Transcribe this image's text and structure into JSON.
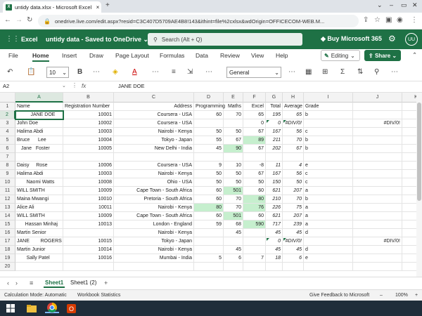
{
  "browser": {
    "tab_title": "untidy data.xlsx - Microsoft Excel",
    "tab_close": "×",
    "new_tab": "+",
    "url": "onedrive.live.com/edit.aspx?resid=C3C407D5709AE4B8!143&ithint=file%2cxlsx&wdOrigin=OFFICECOM-WEB.M..."
  },
  "excel_header": {
    "app_name": "Excel",
    "doc_status": "untidy data  -  Saved to OneDrive ⌄",
    "search_placeholder": "Search (Alt + Q)",
    "buy": "Buy Microsoft 365",
    "avatar": "UU"
  },
  "menu": [
    "File",
    "Home",
    "Insert",
    "Draw",
    "Page Layout",
    "Formulas",
    "Data",
    "Review",
    "View",
    "Help"
  ],
  "active_menu": "Home",
  "editing_label": "Editing",
  "share_label": "Share",
  "ribbon": {
    "font_size": "10",
    "number_format": "General"
  },
  "formula_bar": {
    "name_box": "A2",
    "fx": "fx",
    "value": "JANE DOE"
  },
  "columns": [
    "A",
    "B",
    "C",
    "D",
    "E",
    "F",
    "G",
    "H",
    "I",
    "J",
    "K"
  ],
  "rows": [
    {
      "n": "1",
      "c": [
        "Name",
        "Registration Number",
        "Address",
        "Programming",
        "Maths",
        "Excel",
        "Total",
        "Average",
        "Grade",
        "",
        ""
      ]
    },
    {
      "n": "2",
      "c": [
        "          JANE DOE",
        "10001",
        "Coursera - USA",
        "60",
        "70",
        "65",
        "195",
        "65",
        "b",
        "",
        ""
      ]
    },
    {
      "n": "3",
      "c": [
        "John Doe",
        "10002",
        "Coursera - USA",
        "",
        "",
        "0",
        "0",
        "#DIV/0!",
        "",
        "#DIV/0!",
        ""
      ]
    },
    {
      "n": "4",
      "c": [
        "Halima Abdi",
        "10003",
        "Nairobi - Kenya",
        "50",
        "50",
        "67",
        "167",
        "56",
        "c",
        "",
        ""
      ]
    },
    {
      "n": "5",
      "c": [
        "Bruce      Lee",
        "10004",
        "Tokyo - Japan",
        "55",
        "67",
        "89",
        "211",
        "70",
        "b",
        "",
        ""
      ]
    },
    {
      "n": "6",
      "c": [
        "   Jane   Foster",
        "10005",
        "New Delhi - India",
        "45",
        "90",
        "67",
        "202",
        "67",
        "b",
        "",
        ""
      ]
    },
    {
      "n": "7",
      "c": [
        "",
        "",
        "",
        "",
        "",
        "",
        "",
        "",
        "",
        "",
        ""
      ]
    },
    {
      "n": "8",
      "c": [
        "Daisy     Rose",
        "10006",
        "Coursera - USA",
        "9",
        "10",
        "-8",
        "11",
        "4",
        "e",
        "",
        ""
      ]
    },
    {
      "n": "9",
      "c": [
        "Halima Abdi",
        "10003",
        "Nairobi - Kenya",
        "50",
        "50",
        "67",
        "167",
        "56",
        "c",
        "",
        ""
      ]
    },
    {
      "n": "10",
      "c": [
        "       Naomi Watts",
        "10008",
        "Ohio - USA",
        "50",
        "50",
        "50",
        "150",
        "50",
        "c",
        "",
        ""
      ]
    },
    {
      "n": "11",
      "c": [
        "WILL SMITH",
        "10009",
        "Cape Town - South Africa",
        "60",
        "501",
        "60",
        "621",
        "207",
        "a",
        "",
        ""
      ]
    },
    {
      "n": "12",
      "c": [
        "Maina Mwangi",
        "10010",
        "Pretoria - South Africa",
        "60",
        "70",
        "80",
        "210",
        "70",
        "b",
        "",
        ""
      ]
    },
    {
      "n": "13",
      "c": [
        "Alice Ali",
        "10011",
        "Nairobi - Kenya",
        "80",
        "70",
        "76",
        "226",
        "75",
        "a",
        "",
        ""
      ]
    },
    {
      "n": "14",
      "c": [
        "WILL SMITH",
        "10009",
        "Cape Town - South Africa",
        "60",
        "501",
        "60",
        "621",
        "207",
        "a",
        "",
        ""
      ]
    },
    {
      "n": "15",
      "c": [
        "      Hassan Minhaj",
        "10013",
        "London - England",
        "59",
        "68",
        "590",
        "717",
        "239",
        "a",
        "",
        ""
      ]
    },
    {
      "n": "16",
      "c": [
        "Martin Senior",
        "",
        "Nairobi - Kenya",
        "",
        "45",
        "",
        "45",
        "45",
        "d",
        "",
        ""
      ]
    },
    {
      "n": "17",
      "c": [
        "JANE        ROGERS",
        "10015",
        "Tokyo - Japan",
        "",
        "",
        "",
        "0",
        "#DIV/0!",
        "",
        "#DIV/0!",
        ""
      ]
    },
    {
      "n": "18",
      "c": [
        "Martin Junior",
        "10014",
        "Nairobi - Kenya",
        "",
        "45",
        "",
        "45",
        "45",
        "d",
        "",
        ""
      ]
    },
    {
      "n": "19",
      "c": [
        "       Sally Patel",
        "10016",
        "Mumbai - India",
        "5",
        "6",
        "7",
        "18",
        "6",
        "e",
        "",
        ""
      ]
    },
    {
      "n": "20",
      "c": [
        "",
        "",
        "",
        "",
        "",
        "",
        "",
        "",
        "",
        "",
        ""
      ]
    }
  ],
  "highlight_color": "#c6efce",
  "sheets": [
    "Sheet1",
    "Sheet1 (2)"
  ],
  "active_sheet": "Sheet1",
  "status": {
    "calc": "Calculation Mode: Automatic",
    "stats": "Workbook Statistics",
    "feedback": "Give Feedback to Microsoft",
    "zoom": "100%"
  }
}
